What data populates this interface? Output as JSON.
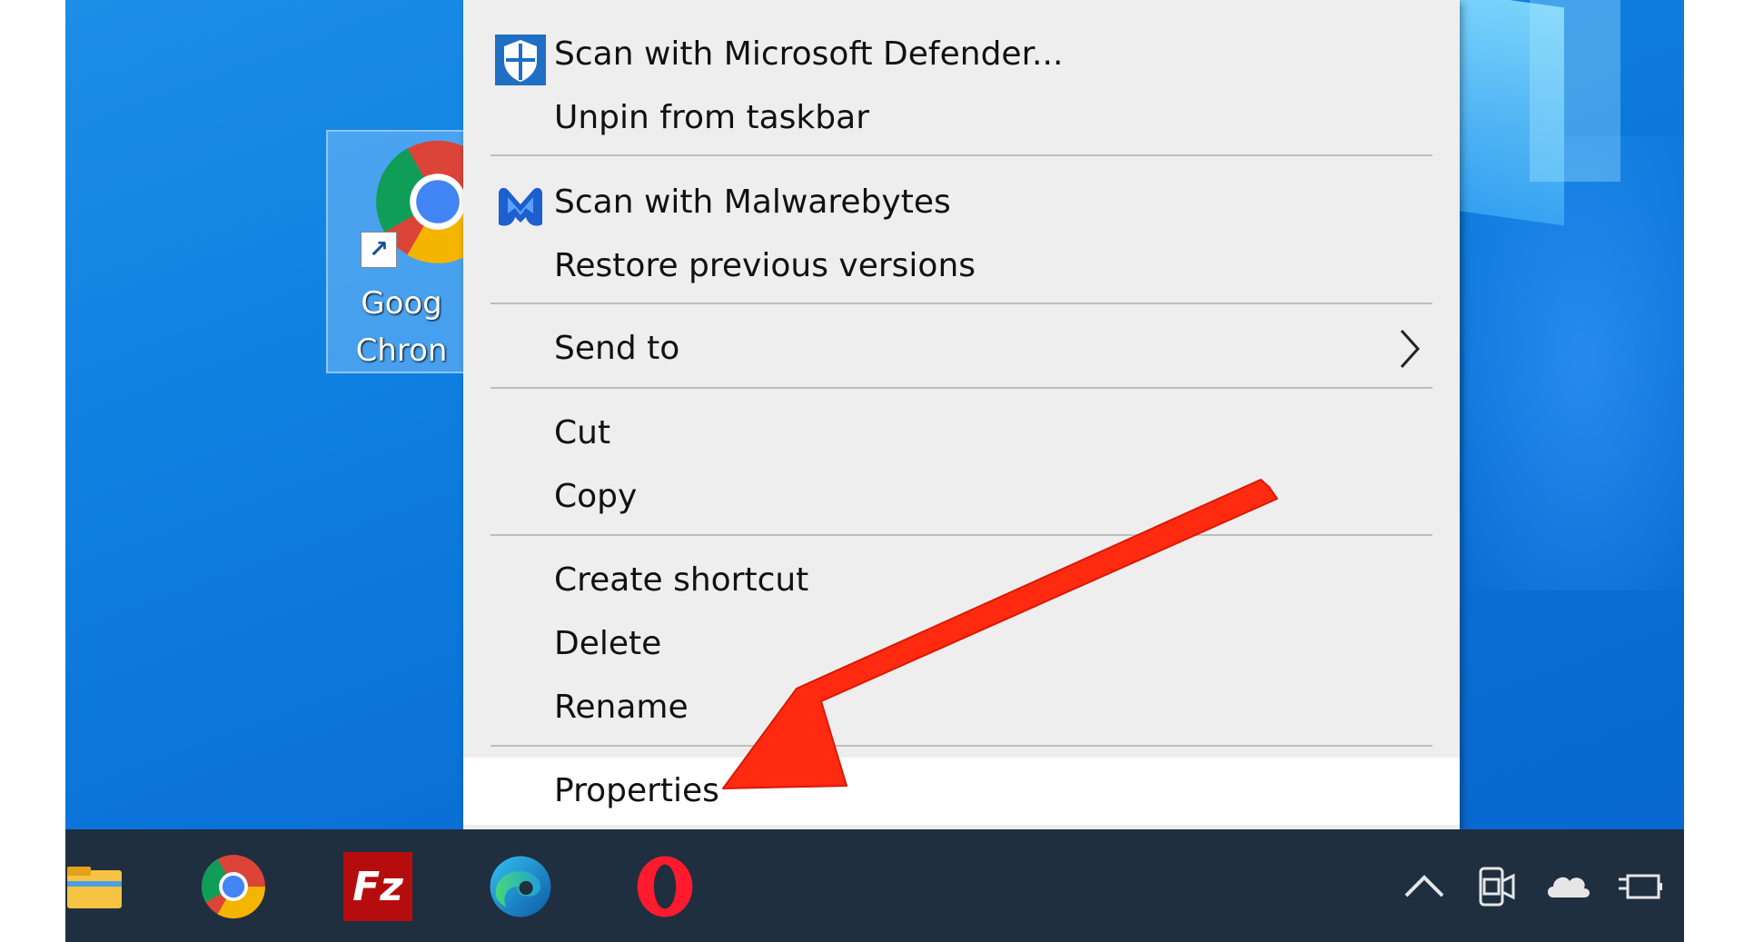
{
  "desktop": {
    "icon": {
      "name_line1": "Goog",
      "name_line2": "Chron",
      "icon": "chrome-icon"
    }
  },
  "context_menu": {
    "items": [
      {
        "label": "Scan with Microsoft Defender...",
        "icon": "defender-shield-icon"
      },
      {
        "label": "Unpin from taskbar"
      },
      {
        "label": "Scan with Malwarebytes",
        "icon": "malwarebytes-icon"
      },
      {
        "label": "Restore previous versions"
      },
      {
        "label": "Send to",
        "has_submenu": true
      },
      {
        "label": "Cut"
      },
      {
        "label": "Copy"
      },
      {
        "label": "Create shortcut"
      },
      {
        "label": "Delete"
      },
      {
        "label": "Rename"
      },
      {
        "label": "Properties",
        "highlighted": true
      }
    ]
  },
  "taskbar": {
    "pinned": [
      "file-explorer-icon",
      "chrome-icon",
      "filezilla-icon",
      "edge-icon",
      "opera-icon"
    ],
    "filezilla_glyph": "Fz",
    "tray": [
      "chevron-up-icon",
      "meet-now-icon",
      "onedrive-cloud-icon",
      "power-plug-icon"
    ]
  },
  "annotation": {
    "type": "red-arrow",
    "points_to": "Properties",
    "color": "#ff2a10"
  }
}
